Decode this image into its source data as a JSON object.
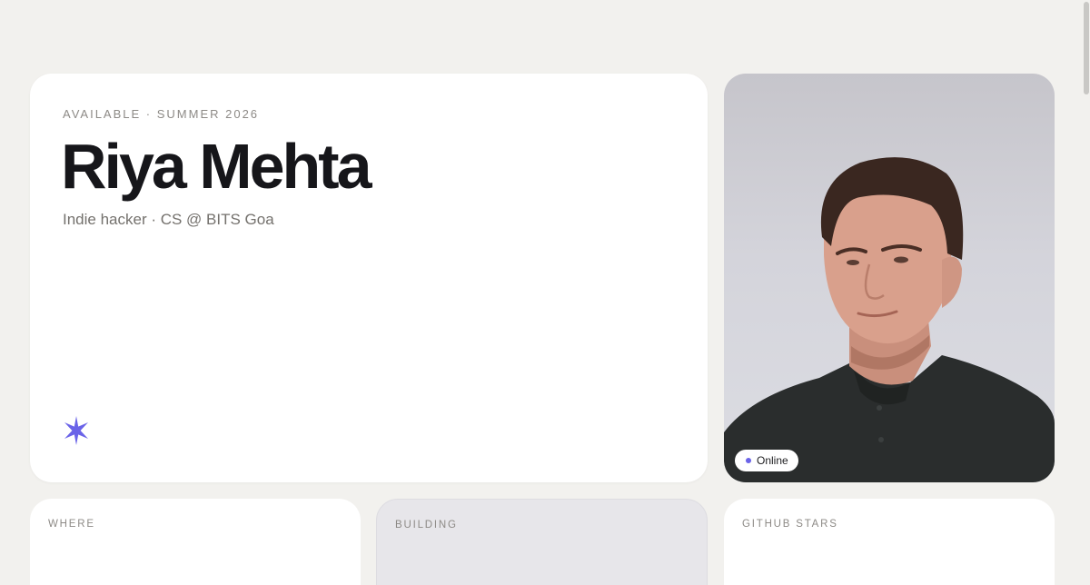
{
  "hero": {
    "eyebrow": "AVAILABLE · SUMMER 2026",
    "name": "Riya Mehta",
    "tagline": "Indie hacker · CS @ BITS Goa",
    "star_icon": "sparkle-star-icon",
    "accent_color": "#6a63e8"
  },
  "photo": {
    "status_label": "Online",
    "status_color": "#6a63e8"
  },
  "tiles": [
    {
      "label": "WHERE"
    },
    {
      "label": "BUILDING"
    },
    {
      "label": "GITHUB STARS"
    }
  ]
}
